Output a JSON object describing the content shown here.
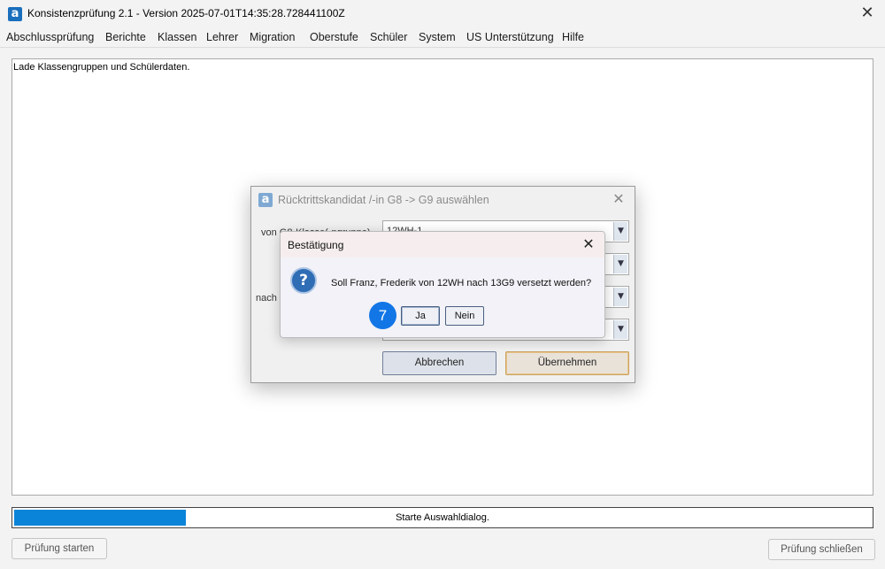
{
  "window": {
    "title": "Konsistenzprüfung 2.1 - Version 2025-07-01T14:35:28.728441100Z",
    "logo_letter": "a",
    "close_glyph": "✕"
  },
  "menu": {
    "items": [
      "Abschlussprüfung",
      "Berichte",
      "Klassen",
      "Lehrer",
      "Migration",
      "Oberstufe",
      "Schüler",
      "System",
      "US Unterstützung",
      "Hilfe"
    ]
  },
  "log": {
    "text": "Lade Klassengruppen und Schülerdaten."
  },
  "progress": {
    "fraction": 0.2,
    "text": "Starte Auswahldialog.",
    "color": "#0a84d8"
  },
  "buttons": {
    "start": "Prüfung starten",
    "close": "Prüfung schließen"
  },
  "dialog": {
    "title": "Rücktrittskandidat /-in G8 -> G9 auswählen",
    "logo_letter": "a",
    "close_glyph": "✕",
    "label_from": "von G8-Klasse(-ngruppe)",
    "label_to": "nach",
    "combo_first_value": "12WH-1",
    "combo_arrow": "▼",
    "cancel": "Abbrechen",
    "apply": "Übernehmen"
  },
  "confirm": {
    "title": "Bestätigung",
    "close_glyph": "✕",
    "icon": "question-icon",
    "icon_glyph": "?",
    "message": "Soll Franz, Frederik von 12WH nach 13G9 versetzt werden?",
    "yes": "Ja",
    "no": "Nein"
  },
  "badge": {
    "number": "7",
    "color": "#1276e6"
  }
}
